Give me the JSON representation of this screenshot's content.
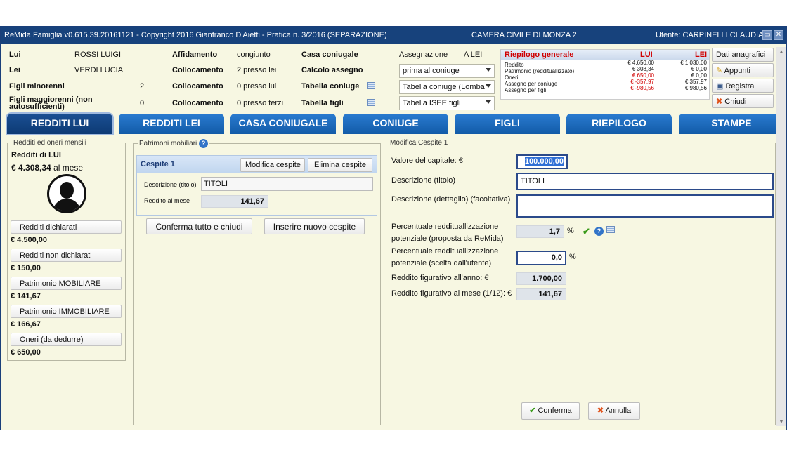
{
  "titlebar": {
    "app": "ReMida Famiglia v0.615.39.20161121 - Copyright 2016 Gianfranco D'Aietti - Pratica n. 3/2016 (SEPARAZIONE)",
    "court": "CAMERA CIVILE DI MONZA 2",
    "user": "Utente: CARPINELLI CLAUDIA"
  },
  "header": {
    "lui_label": "Lui",
    "lui_name": "ROSSI LUIGI",
    "lei_label": "Lei",
    "lei_name": "VERDI LUCIA",
    "minori_label": "Figli minorenni",
    "minori_count": "2",
    "maggiori_label": "Figli maggiorenni (non autosufficienti)",
    "maggiori_count": "0",
    "affidamento_label": "Affidamento",
    "affidamento_value": "congiunto",
    "coll1_label": "Collocamento",
    "coll1_value": "2 presso lei",
    "coll2_label": "Collocamento",
    "coll2_value": "0 presso lui",
    "coll3_label": "Collocamento",
    "coll3_value": "0 presso terzi",
    "casa_label": "Casa coniugale",
    "calcolo_label": "Calcolo assegno",
    "tabella_coniuge_label": "Tabella coniuge",
    "tabella_figli_label": "Tabella figli",
    "assegnazione_label": "Assegnazione",
    "assegnazione_value": "A LEI",
    "select_calcolo": "prima al coniuge",
    "select_tab_coniuge": "Tabella coniuge (Lomba",
    "select_tab_figli": "Tabella ISEE figli"
  },
  "riepilogo": {
    "title": "Riepilogo generale",
    "col_lui": "LUI",
    "col_lei": "LEI",
    "rows": [
      {
        "label": "Reddito",
        "lui": "€ 4.650,00",
        "lei": "€ 1.030,00",
        "red": false
      },
      {
        "label": "Patrimonio (reddituallizzato)",
        "lui": "€ 308,34",
        "lei": "€ 0,00",
        "red": false
      },
      {
        "label": "Oneri",
        "lui": "€ 650,00",
        "lei": "€ 0,00",
        "red": true
      },
      {
        "label": "Assegno per coniuge",
        "lui": "€ -357,97",
        "lei": "€ 357,97",
        "red": true
      },
      {
        "label": "Assegno per figli",
        "lui": "€ -980,56",
        "lei": "€ 980,56",
        "red": true
      }
    ]
  },
  "side_buttons": {
    "dati": "Dati anagrafici",
    "appunti": "Appunti",
    "registra": "Registra",
    "chiudi": "Chiudi"
  },
  "tabs": [
    "REDDITI LUI",
    "REDDITI LEI",
    "CASA CONIUGALE",
    "CONIUGE",
    "FIGLI",
    "RIEPILOGO",
    "STAMPE"
  ],
  "left": {
    "legend": "Redditi ed oneri mensili",
    "title": "Redditi di LUI",
    "total": "€ 4.308,34",
    "total_suffix": "al mese",
    "items": [
      {
        "label": "Redditi dichiarati",
        "amount": "€ 4.500,00"
      },
      {
        "label": "Redditi non dichiarati",
        "amount": "€ 150,00"
      },
      {
        "label": "Patrimonio MOBILIARE",
        "amount": "€ 141,67"
      },
      {
        "label": "Patrimonio IMMOBILIARE",
        "amount": "€ 166,67"
      },
      {
        "label": "Oneri (da dedurre)",
        "amount": "€ 650,00"
      }
    ]
  },
  "middle": {
    "legend": "Patrimoni mobiliari",
    "cespite_title": "Cespite 1",
    "modifica": "Modifica cespite",
    "elimina": "Elimina cespite",
    "desc_label": "Descrizione (titolo)",
    "desc_value": "TITOLI",
    "reddito_label": "Reddito al mese",
    "reddito_value": "141,67",
    "conferma_tutto": "Conferma tutto e chiudi",
    "inserire": "Inserire nuovo cespite"
  },
  "right": {
    "legend": "Modifica Cespite 1",
    "valore_label": "Valore del capitale: €",
    "valore_value": "100.000,00",
    "desc_label": "Descrizione (titolo)",
    "desc_value": "TITOLI",
    "dettaglio_label": "Descrizione (dettaglio) (facoltativa)",
    "dettaglio_value": "",
    "perc1_label_a": "Percentuale reddituallizzazione",
    "perc1_label_b": "potenziale (proposta da ReMida)",
    "perc1_value": "1,7",
    "perc_unit": "%",
    "perc2_label_a": "Percentuale reddituallizzazione",
    "perc2_label_b": "potenziale (scelta dall'utente)",
    "perc2_value": "0,0",
    "anno_label": "Reddito figurativo all'anno: €",
    "anno_value": "1.700,00",
    "mese_label": "Reddito figurativo al mese (1/12): €",
    "mese_value": "141,67",
    "conferma": "Conferma",
    "annulla": "Annulla"
  }
}
